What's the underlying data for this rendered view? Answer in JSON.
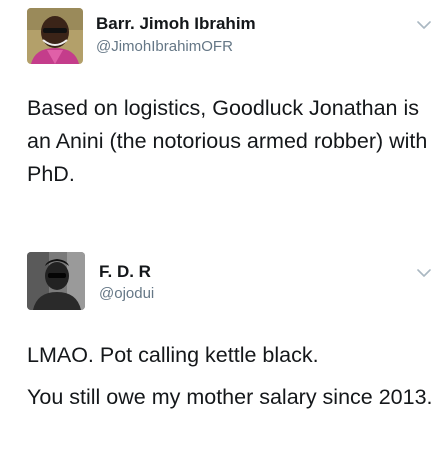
{
  "tweets": [
    {
      "display_name": "Barr. Jimoh Ibrahim",
      "handle": "@JimohIbrahimOFR",
      "avatar_icon": "user-avatar-portrait",
      "menu_icon": "chevron-down-icon",
      "text_paragraphs": [
        "Based on logistics, Goodluck Jonathan is an Anini (the notorious armed robber) with PhD."
      ]
    },
    {
      "display_name": "F. D. R",
      "handle": "@ojodui",
      "avatar_icon": "user-avatar-bw-portrait",
      "menu_icon": "chevron-down-icon",
      "text_paragraphs": [
        "LMAO. Pot calling kettle black.",
        "You still owe my mother salary since 2013."
      ]
    }
  ],
  "colors": {
    "name": "#14171a",
    "handle": "#657786",
    "chevron": "#aab8c2",
    "background": "#ffffff"
  }
}
